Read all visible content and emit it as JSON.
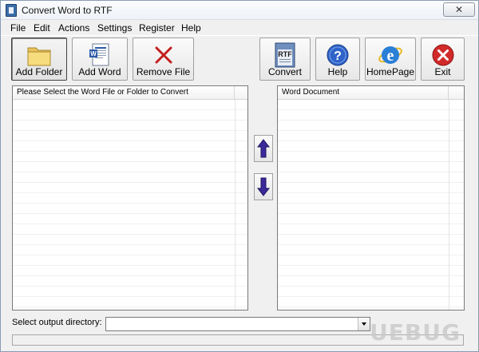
{
  "window": {
    "title": "Convert Word to RTF",
    "close_glyph": "✕"
  },
  "menu": [
    "File",
    "Edit",
    "Actions",
    "Settings",
    "Register",
    "Help"
  ],
  "toolbar": {
    "add_folder": "Add Folder",
    "add_word": "Add Word",
    "remove_file": "Remove File",
    "convert": "Convert",
    "convert_icon_text": "RTF",
    "help": "Help",
    "homepage": "HomePage",
    "exit": "Exit"
  },
  "left_panel": {
    "header": "Please Select the Word File or Folder to Convert"
  },
  "right_panel": {
    "header": "Word Document"
  },
  "output": {
    "label": "Select  output directory:",
    "value": ""
  },
  "watermark": "UEBUG",
  "colors": {
    "arrow": "#3a2a9a",
    "accent": "#3a6ea8"
  }
}
